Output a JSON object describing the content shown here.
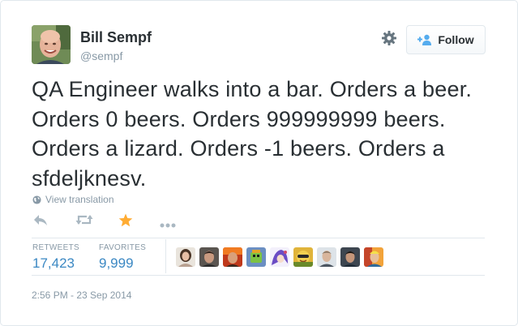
{
  "author": {
    "name": "Bill Sempf",
    "handle": "@sempf",
    "avatar_icon": "bald-man-smiling-avatar"
  },
  "header": {
    "settings_icon": "gear-icon",
    "follow_label": "Follow",
    "follow_icon": "add-user-icon"
  },
  "tweet": {
    "text": "QA Engineer walks into a bar. Orders a beer. Orders 0 beers. Orders 999999999 beers. Orders a lizard. Orders -1 beers. Orders a sfdeljknesv.",
    "translation_label": "View translation",
    "translation_icon": "globe-icon"
  },
  "actions": {
    "items": [
      {
        "name": "reply",
        "icon": "reply-arrow-icon",
        "color": "#aab8c2"
      },
      {
        "name": "retweet",
        "icon": "retweet-icon",
        "color": "#aab8c2"
      },
      {
        "name": "favorite",
        "icon": "star-icon",
        "color": "#ffac33"
      },
      {
        "name": "more",
        "icon": "ellipsis-icon",
        "color": "#aab8c2"
      }
    ]
  },
  "stats": {
    "retweets_label": "RETWEETS",
    "retweets_value": "17,423",
    "favorites_label": "FAVORITES",
    "favorites_value": "9,999"
  },
  "favoriters": [
    {
      "icon": "woman-avatar"
    },
    {
      "icon": "man-dark-hair-avatar"
    },
    {
      "icon": "man-fire-avatar"
    },
    {
      "icon": "cartoon-green-avatar"
    },
    {
      "icon": "anime-purple-avatar"
    },
    {
      "icon": "yellow-cartoon-avatar"
    },
    {
      "icon": "man-light-avatar"
    },
    {
      "icon": "man-dark-avatar"
    },
    {
      "icon": "colorful-avatar"
    }
  ],
  "timestamp": "2:56 PM - 23 Sep 2014",
  "colors": {
    "link_blue": "#3b88c3",
    "muted_gray": "#8899a6",
    "star_orange": "#ffac33",
    "text_dark": "#292f33",
    "border": "#e1e8ed"
  }
}
